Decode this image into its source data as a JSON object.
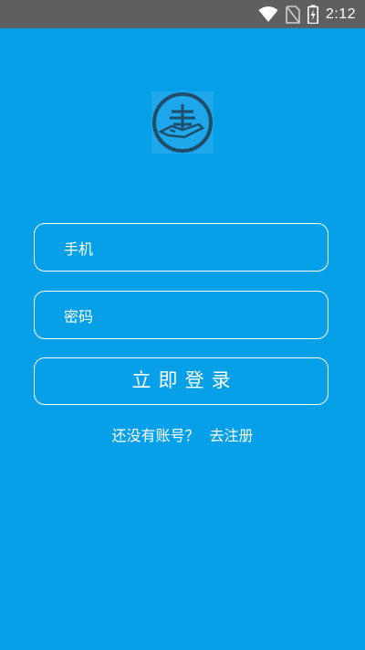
{
  "status_bar": {
    "time": "2:12",
    "icons": [
      "wifi-icon",
      "no-sim-icon",
      "battery-charging-icon"
    ]
  },
  "app": {
    "logo_icon": "book-hand-logo-icon"
  },
  "login_form": {
    "phone_placeholder": "手机",
    "password_placeholder": "密码",
    "login_button_label": "立即登录",
    "no_account_text": "还没有账号？",
    "register_link_text": "去注册"
  },
  "colors": {
    "background": "#06a0e8",
    "status_bar": "#5f5f5f",
    "accent": "#ffffff"
  }
}
